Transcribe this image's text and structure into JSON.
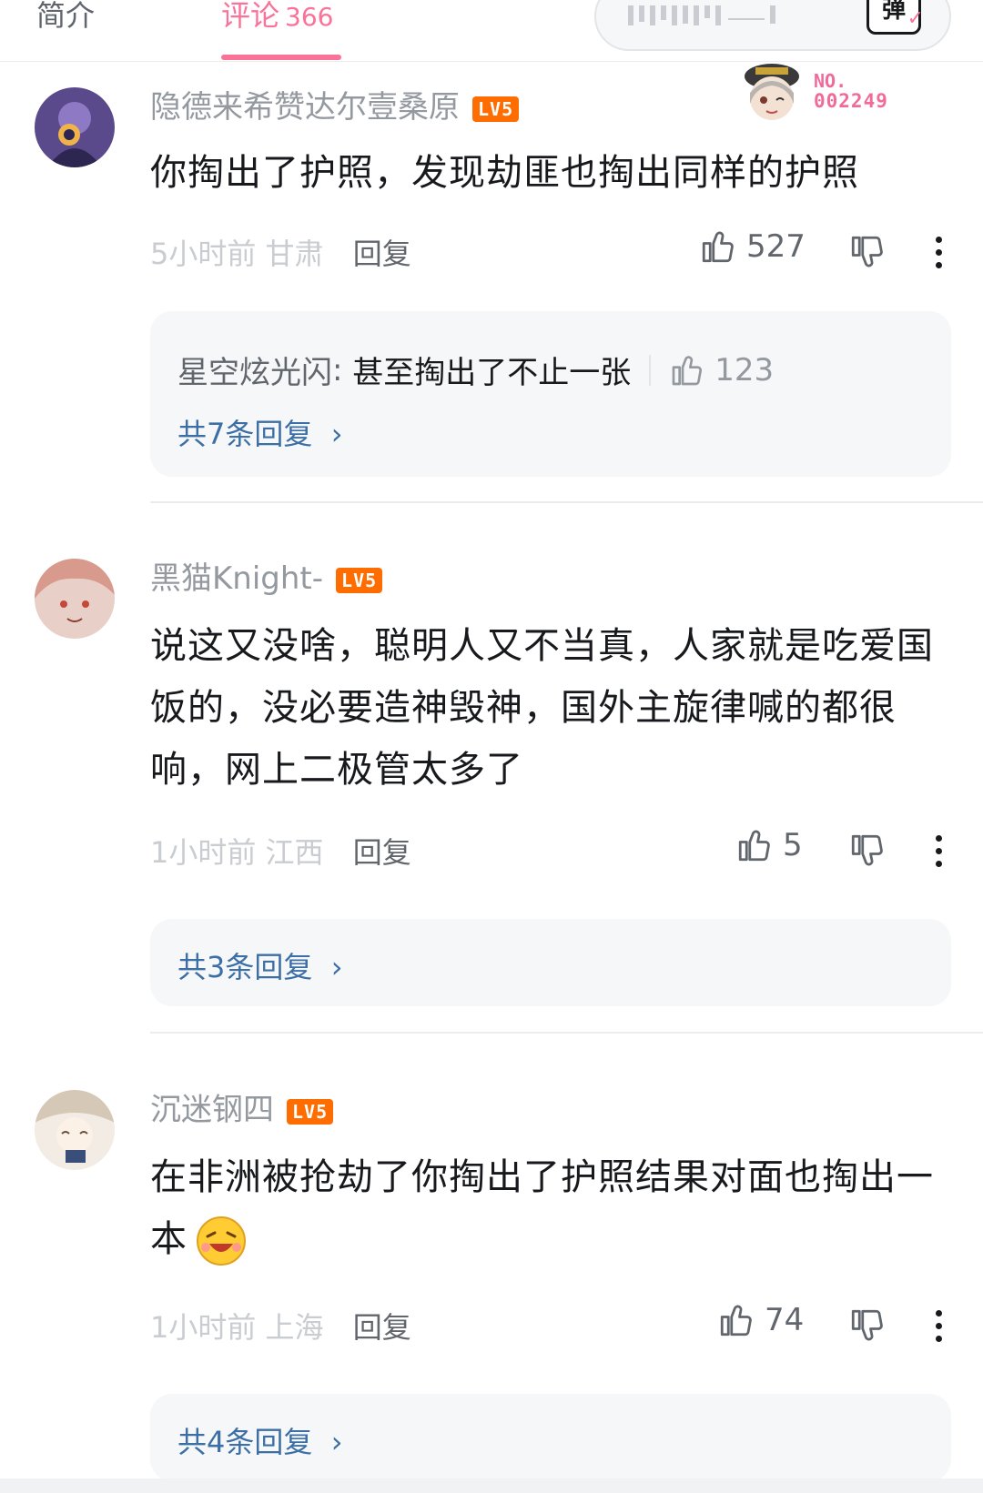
{
  "tabs": {
    "intro": "简介",
    "comments": "评论",
    "comments_count": "366",
    "danmaku_button": "弹"
  },
  "badge": {
    "label": "NO.",
    "number": "002249"
  },
  "comments": [
    {
      "username": "隐德来希赞达尔壹桑原",
      "level": "LV5",
      "content": "你掏出了护照，发现劫匪也掏出同样的护照",
      "time": "5小时前",
      "location": "甘肃",
      "reply_label": "回复",
      "likes": "527",
      "sub_reply": {
        "user": "星空炫光闪",
        "text": "甚至掏出了不止一张",
        "likes": "123"
      },
      "reply_count": "共7条回复"
    },
    {
      "username": "黑猫Knight-",
      "level": "LV5",
      "content": "说这又没啥，聪明人又不当真，人家就是吃爱国饭的，没必要造神毁神，国外主旋律喊的都很响，网上二极管太多了",
      "time": "1小时前",
      "location": "江西",
      "reply_label": "回复",
      "likes": "5",
      "reply_count": "共3条回复"
    },
    {
      "username": "沉迷钢四",
      "level": "LV5",
      "content": "在非洲被抢劫了你掏出了护照结果对面也掏出一本",
      "time": "1小时前",
      "location": "上海",
      "reply_label": "回复",
      "likes": "74",
      "reply_count": "共4条回复"
    }
  ],
  "colors": {
    "accent": "#fb7299",
    "link": "#3c6fa5",
    "level": "#ff6c00"
  }
}
